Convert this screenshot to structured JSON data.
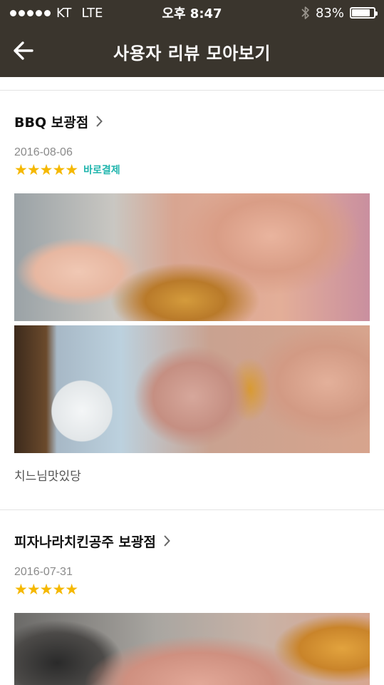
{
  "status_bar": {
    "signal_dots_filled": 5,
    "carrier": "KT",
    "network": "LTE",
    "time": "오후 8:47",
    "bluetooth_icon": "bluetooth-icon",
    "battery_percent_text": "83%",
    "battery_level": 0.83
  },
  "header": {
    "back_icon": "back-arrow-icon",
    "title": "사용자 리뷰 모아보기"
  },
  "reviews": [
    {
      "store": "BBQ 보광점",
      "date": "2016-08-06",
      "rating": 5,
      "stars": "★★★★★",
      "badge": "바로결제",
      "photos": 2,
      "comment": "치느님맛있당"
    },
    {
      "store": "피자나라치킨공주 보광점",
      "date": "2016-07-31",
      "rating": 5,
      "stars": "★★★★★",
      "badge": "",
      "photos": 1,
      "comment": ""
    }
  ],
  "colors": {
    "header_bg": "#3a352d",
    "star": "#f5b800",
    "badge": "#1fb5ad",
    "date": "#8a8a8a"
  }
}
